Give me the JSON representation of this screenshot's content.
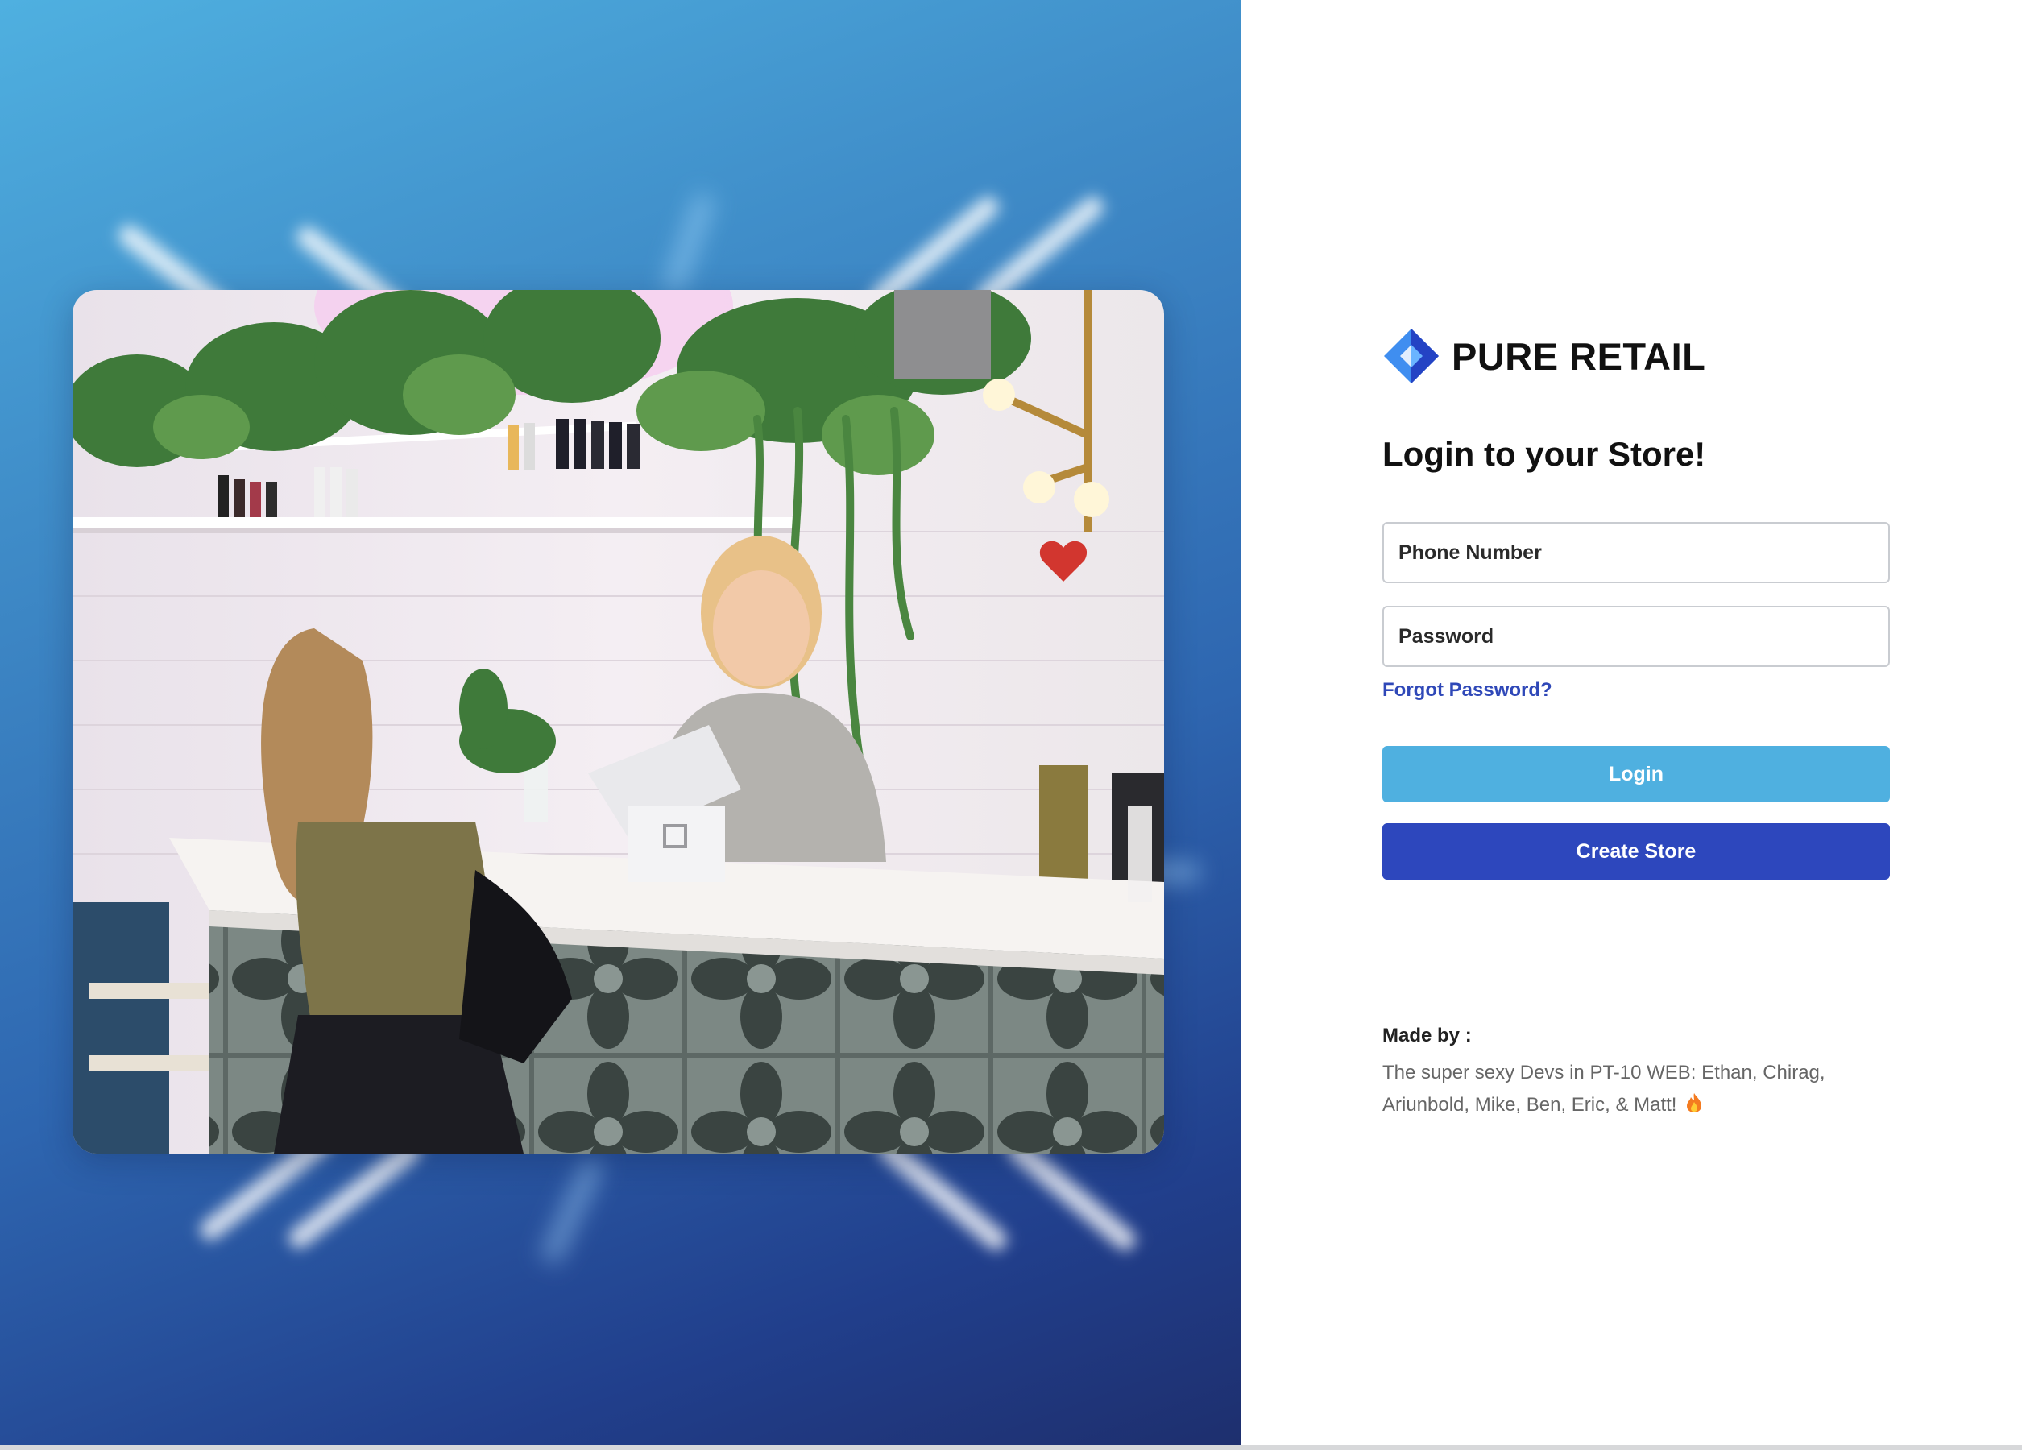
{
  "brand": {
    "name": "PURE RETAIL",
    "logo_icon": "diamond-logo-icon",
    "logo_colors": [
      "#3f8ef0",
      "#2443c4"
    ]
  },
  "hero": {
    "image_description_icon": "storefront-photo",
    "gradient_colors": [
      "#4fb0e0",
      "#2e66b0",
      "#1e2f6e"
    ]
  },
  "login": {
    "title": "Login to your Store!",
    "phone_placeholder": "Phone Number",
    "phone_value": "",
    "password_placeholder": "Password",
    "password_value": "",
    "forgot_password_label": "Forgot Password?",
    "login_button_label": "Login",
    "create_store_button_label": "Create Store"
  },
  "credits": {
    "label": "Made by :",
    "text": "The super sexy Devs in PT-10 WEB: Ethan, Chirag, Ariunbold, Mike, Ben, Eric, & Matt!",
    "emoji_icon": "fire-icon"
  },
  "colors": {
    "accent_light": "#4fb0e0",
    "accent_dark": "#2d47bd",
    "link": "#2f48b8"
  }
}
